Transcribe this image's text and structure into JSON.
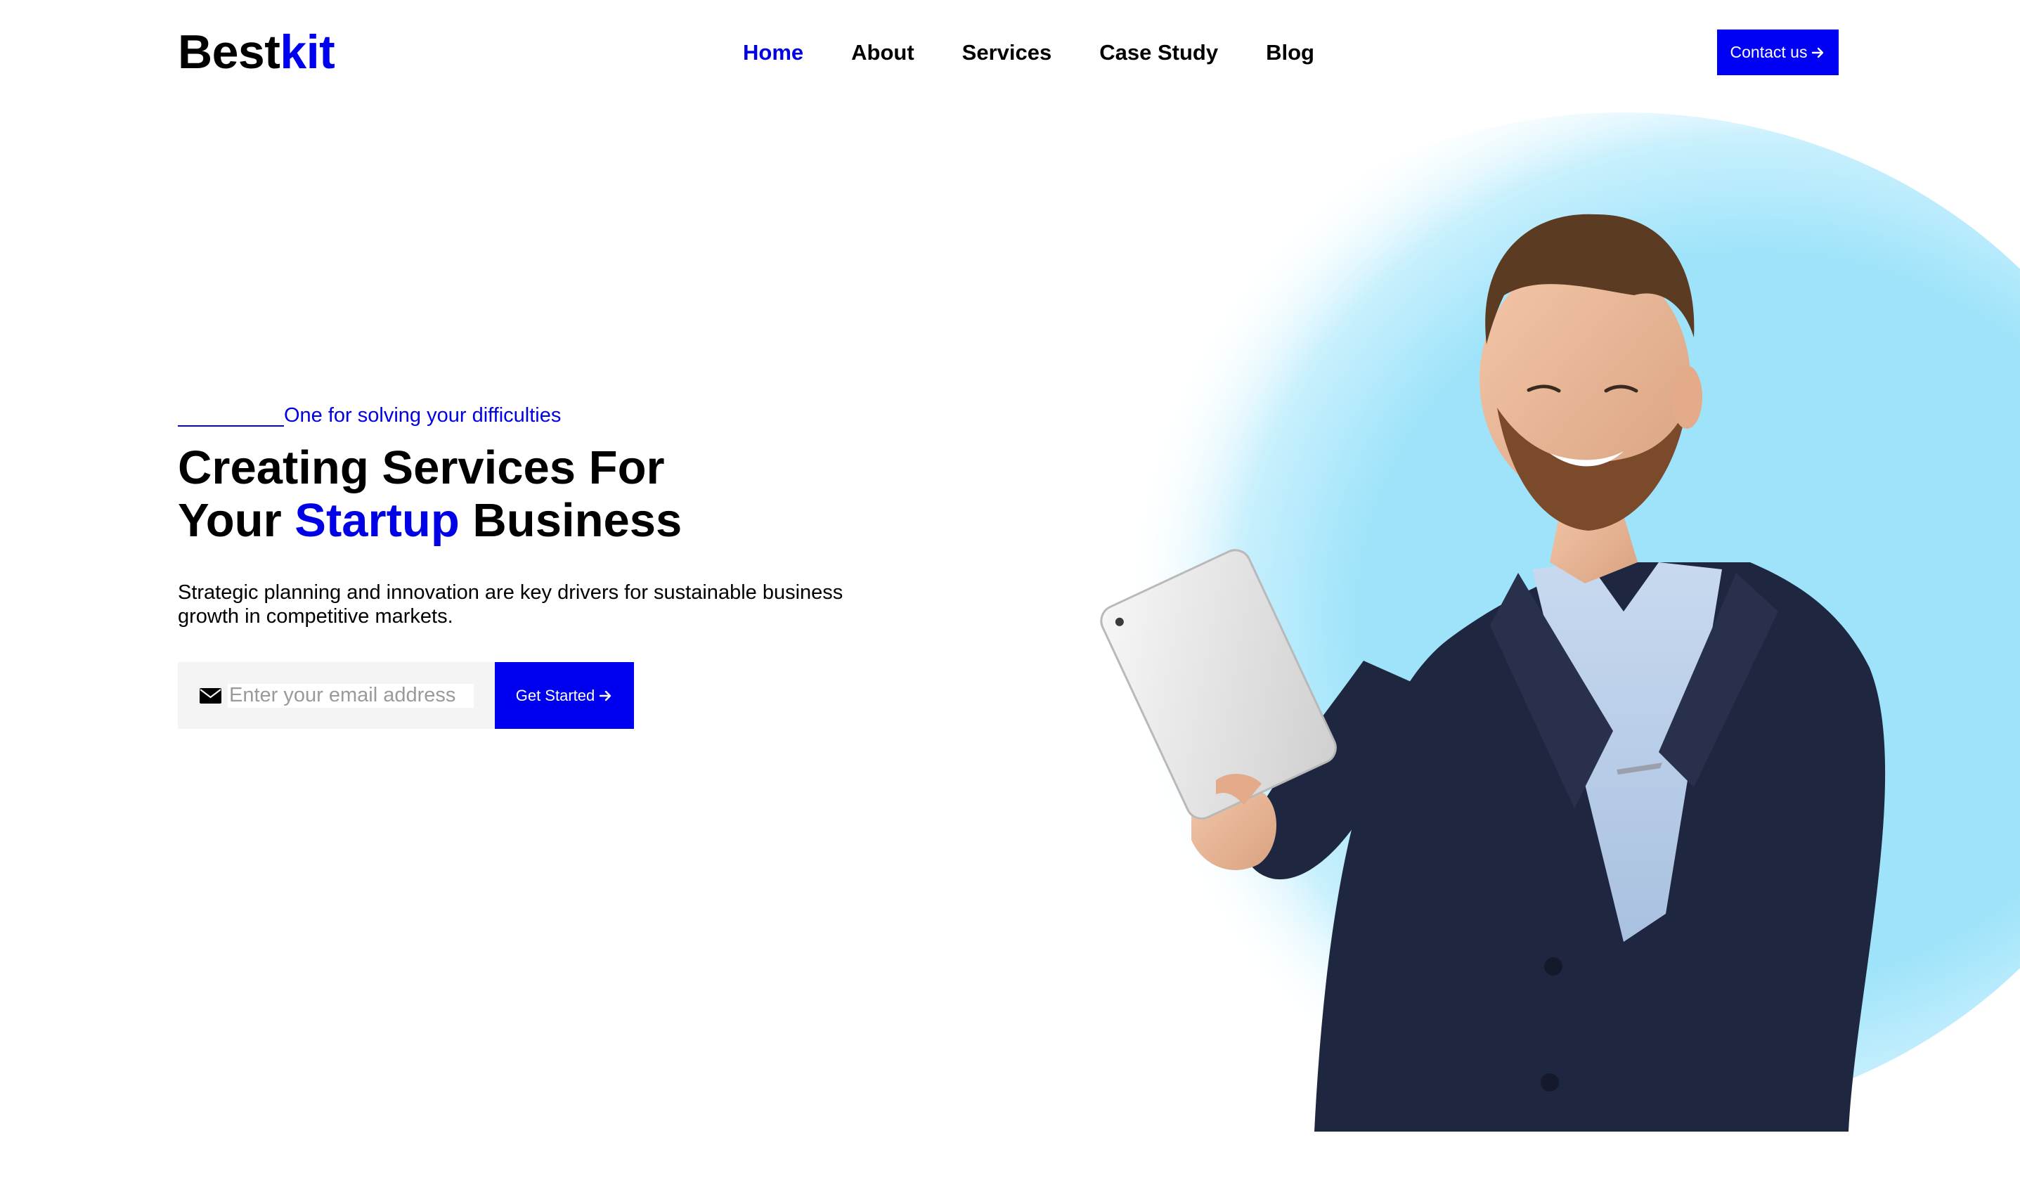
{
  "brand": {
    "logo_part1": "Best",
    "logo_part2": "kit",
    "accent_color": "#0000f0"
  },
  "nav": {
    "items": [
      {
        "label": "Home",
        "active": true
      },
      {
        "label": "About",
        "active": false
      },
      {
        "label": "Services",
        "active": false
      },
      {
        "label": "Case Study",
        "active": false
      },
      {
        "label": "Blog",
        "active": false
      }
    ],
    "cta_label": "Contact us",
    "cta_icon": "arrow-right-icon"
  },
  "hero": {
    "tagline": "One for solving your difficulties",
    "headline_line1": "Creating Services For",
    "headline_line2_prefix": "Your ",
    "headline_line2_accent": "Startup",
    "headline_line2_suffix": " Business",
    "description": "Strategic planning and innovation are key drivers for sustainable business growth in competitive markets.",
    "email_placeholder": "Enter your email address",
    "email_icon": "envelope-icon",
    "submit_label": "Get Started",
    "submit_icon": "arrow-right-icon",
    "image_subject": "smiling bearded man in navy blazer holding a white tablet",
    "glow_color": "#9ee3fa"
  }
}
